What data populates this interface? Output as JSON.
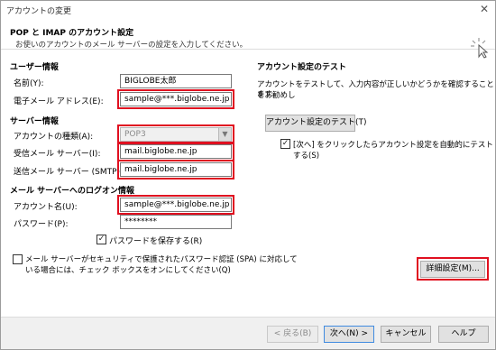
{
  "window": {
    "title": "アカウントの変更",
    "close_glyph": "✕"
  },
  "header": {
    "title": "POP と IMAP のアカウント設定",
    "description": "お使いのアカウントのメール サーバーの設定を入力してください。"
  },
  "user_info": {
    "section": "ユーザー情報",
    "name_label": "名前(Y):",
    "name_value": "BIGLOBE太郎",
    "email_label": "電子メール アドレス(E):",
    "email_value": "sample@***.biglobe.ne.jp"
  },
  "server_info": {
    "section": "サーバー情報",
    "account_type_label": "アカウントの種類(A):",
    "account_type_value": "POP3",
    "incoming_label": "受信メール サーバー(I):",
    "incoming_value": "mail.biglobe.ne.jp",
    "outgoing_label": "送信メール サーバー (SMTP)(O):",
    "outgoing_value": "mail.biglobe.ne.jp"
  },
  "logon_info": {
    "section": "メール サーバーへのログオン情報",
    "account_name_label": "アカウント名(U):",
    "account_name_value": "sample@***.biglobe.ne.jp",
    "password_label": "パスワード(P):",
    "password_value": "********",
    "save_password_label": "パスワードを保存する(R)",
    "save_password_checked": true,
    "spa_label_line1": "メール サーバーがセキュリティで保護されたパスワード認証 (SPA) に対応して",
    "spa_label_line2": "いる場合には、チェック ボックスをオンにしてください(Q)",
    "spa_checked": false
  },
  "test": {
    "section": "アカウント設定のテスト",
    "desc_line1": "アカウントをテストして、入力内容が正しいかどうかを確認することをお勧めし",
    "desc_line2": "ます。",
    "test_button": "アカウント設定のテスト(T)",
    "auto_test_label": "[次へ] をクリックしたらアカウント設定を自動的にテストする(S)",
    "auto_test_checked": true
  },
  "more_settings_button": "詳細設定(M)...",
  "footer": {
    "back": "< 戻る(B)",
    "next": "次へ(N) >",
    "cancel": "キャンセル",
    "help": "ヘルプ"
  },
  "colors": {
    "highlight": "#e01020",
    "focus_border": "#3f8ae0"
  }
}
